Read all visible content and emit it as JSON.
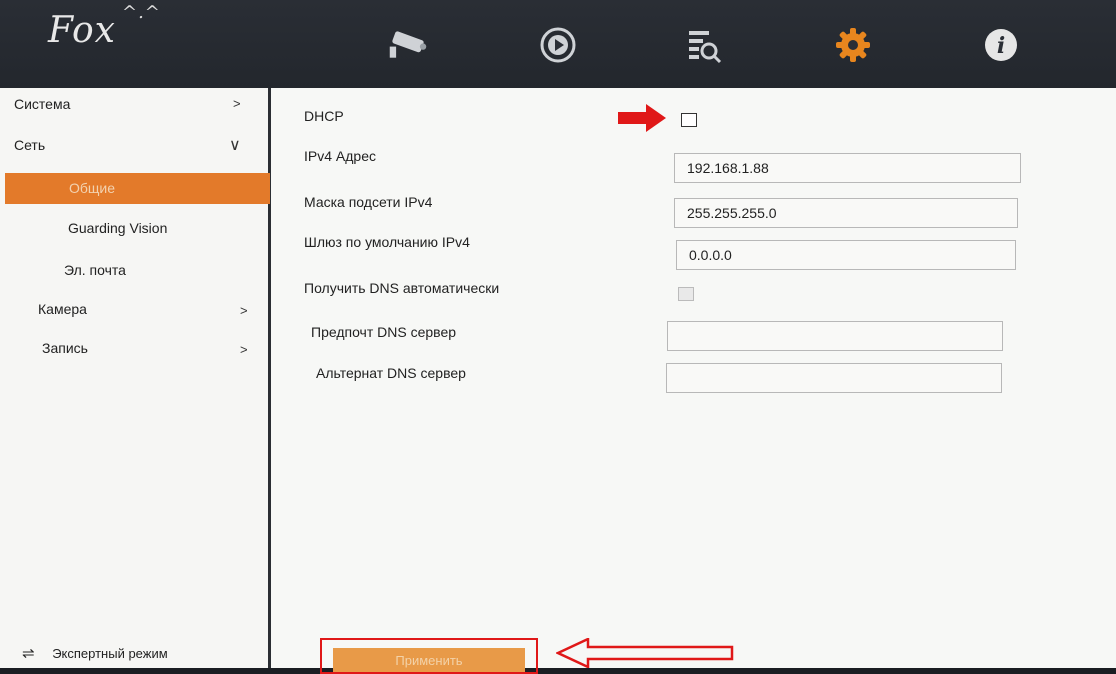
{
  "header": {
    "logo_text": "Fox",
    "icons": [
      "camera-icon",
      "playback-icon",
      "search-icon",
      "settings-icon",
      "info-icon"
    ],
    "active_color": "#e8861e"
  },
  "sidebar": {
    "items": [
      {
        "label": "Система",
        "arrow": ">"
      },
      {
        "label": "Сеть",
        "arrow": "∨"
      },
      {
        "label": "Общие"
      },
      {
        "label": "Guarding Vision"
      },
      {
        "label": "Эл. почта"
      },
      {
        "label": "Камера",
        "arrow": ">"
      },
      {
        "label": "Запись",
        "arrow": ">"
      }
    ],
    "expert_icon": "⇌",
    "expert_label": "Экспертный режим",
    "active_color": "#e37a2a"
  },
  "form": {
    "dhcp_label": "DHCP",
    "ipv4_label": "IPv4 Адрес",
    "ipv4_value": "192.168.1.88",
    "mask_label": "Маска подсети IPv4",
    "mask_value": "255.255.255.0",
    "gateway_label": "Шлюз по умолчанию IPv4",
    "gateway_value": "0.0.0.0",
    "dns_auto_label": "Получить DNS автоматически",
    "dns_pref_label": "Предпочт DNS сервер",
    "dns_pref_value": "",
    "dns_alt_label": "Альтернат DNS сервер",
    "dns_alt_value": ""
  },
  "apply_label": "Применить",
  "annotation_color": "#e01818"
}
